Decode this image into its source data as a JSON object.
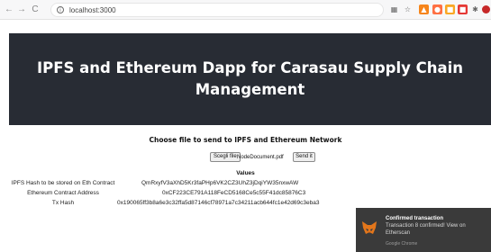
{
  "browser": {
    "url": "localhost:3000",
    "toolbar_icons": [
      "translate-icon",
      "star-icon",
      "metamask-icon",
      "extension-icon",
      "extension-icon",
      "extension-icon",
      "puzzle-icon",
      "profile-icon"
    ]
  },
  "app": {
    "title": "IPFS and Ethereum Dapp for Carasau Supply Chain Management",
    "upload_heading": "Choose file to send to IPFS and Ethereum Network",
    "choose_file_label": "Scegli file",
    "file_name": "NodeDocument.pdf",
    "send_label": "Send it",
    "values_heading": "Values",
    "rows": [
      {
        "label": "IPFS Hash to be stored on Eth Contract",
        "value": "QmRxyfV3aXhD5Kr3faPHp6VK2CZ3UhZ3jDqiYW35nxwAW"
      },
      {
        "label": "Ethereum Contract Address",
        "value": "0xCF223CE791A118FeCD5168Ce5c55F41dc85876C3"
      },
      {
        "label": "Tx Hash",
        "value": "0x190065ff3b8a6e3c32ffa5d87146cf78971a7c34211acb644fc1e42d69c3eba3"
      }
    ]
  },
  "notification": {
    "title": "Confirmed transaction",
    "body": "Transaction 8 confirmed! View on Etherscan",
    "source": "Google Chrome"
  },
  "colors": {
    "hero_bg": "#282c34",
    "toast_bg": "#3a3a3a"
  }
}
